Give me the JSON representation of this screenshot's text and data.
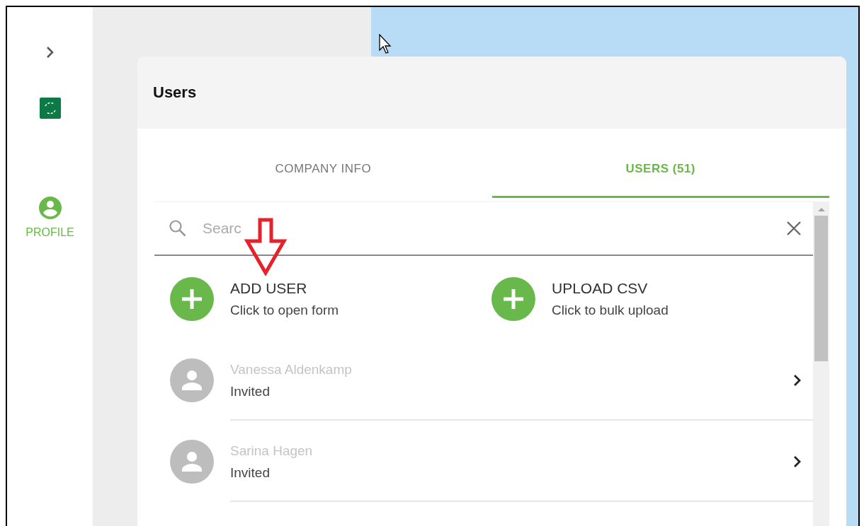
{
  "sidebar": {
    "profile_label": "PROFILE"
  },
  "panel": {
    "title": "Users"
  },
  "tabs": [
    {
      "label": "COMPANY INFO",
      "selected": false
    },
    {
      "label": "USERS (51)",
      "selected": true
    }
  ],
  "search": {
    "placeholder": "Searc"
  },
  "actions": [
    {
      "title": "ADD USER",
      "subtitle": "Click to open form"
    },
    {
      "title": "UPLOAD CSV",
      "subtitle": "Click to bulk upload"
    }
  ],
  "users": [
    {
      "name": "Vanessa Aldenkamp",
      "status": "Invited"
    },
    {
      "name": "Sarina Hagen",
      "status": "Invited"
    }
  ]
}
